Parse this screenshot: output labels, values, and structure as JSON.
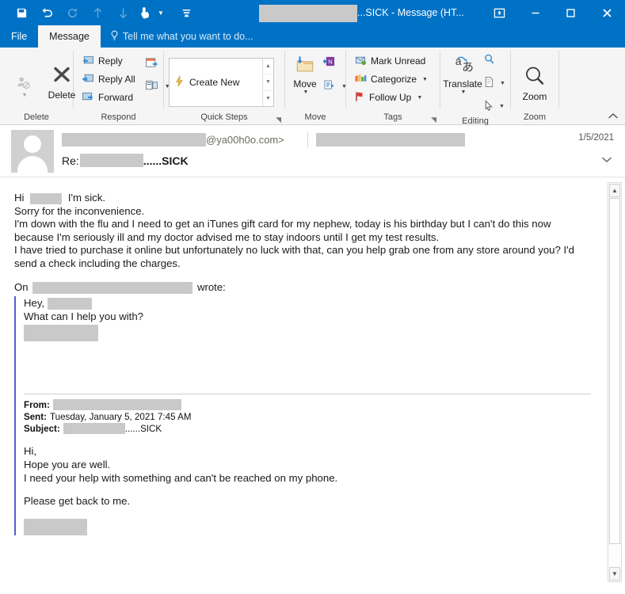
{
  "window": {
    "title_suffix": "...SICK - Message (HT...",
    "redacted_title": "",
    "quick_access": [
      {
        "name": "save-icon",
        "label": "Save",
        "enabled": true
      },
      {
        "name": "undo-icon",
        "label": "Undo",
        "enabled": true
      },
      {
        "name": "redo-icon",
        "label": "Redo",
        "enabled": false
      },
      {
        "name": "previous-item-icon",
        "label": "Previous Item",
        "enabled": false
      },
      {
        "name": "next-item-icon",
        "label": "Next Item",
        "enabled": false
      },
      {
        "name": "touch-mouse-mode-icon",
        "label": "Touch/Mouse Mode",
        "enabled": true
      },
      {
        "name": "customize-quick-access-toolbar-icon",
        "label": "Customize Quick Access Toolbar",
        "enabled": true
      }
    ],
    "controls": [
      {
        "name": "ribbon-display-options-button",
        "label": "Ribbon Display Options"
      },
      {
        "name": "minimize-button",
        "label": "Minimize"
      },
      {
        "name": "maximize-button",
        "label": "Maximize"
      },
      {
        "name": "close-button",
        "label": "Close"
      }
    ]
  },
  "tabs": {
    "file": "File",
    "message": "Message",
    "tellme_placeholder": "Tell me what you want to do..."
  },
  "ribbon": {
    "groups": [
      {
        "label": "Delete"
      },
      {
        "label": "Respond"
      },
      {
        "label": "Quick Steps"
      },
      {
        "label": "Move"
      },
      {
        "label": "Tags"
      },
      {
        "label": "Editing"
      },
      {
        "label": "Zoom"
      }
    ],
    "delete": {
      "ignore_label": "",
      "delete_label": "Delete"
    },
    "respond": {
      "reply": "Reply",
      "reply_all": "Reply All",
      "forward": "Forward"
    },
    "quick_steps": {
      "create_new": "Create New"
    },
    "move": {
      "move_label": "Move"
    },
    "tags": {
      "mark_unread": "Mark Unread",
      "categorize": "Categorize",
      "follow_up": "Follow Up"
    },
    "editing": {
      "translate": "Translate"
    },
    "zoom": {
      "zoom_label": "Zoom"
    }
  },
  "message_header": {
    "sender_redacted": "",
    "sender_domain": "@ya00h0o.com>",
    "recipient_redacted": "",
    "date": "1/5/2021",
    "subject_prefix": "Re:",
    "subject_redacted": "",
    "subject_suffix": "......SICK"
  },
  "body": {
    "greeting_prefix": "Hi",
    "greeting_suffix": "I'm sick.",
    "lines": [
      "Sorry for the inconvenience.",
      "I'm down with the flu and I need to get an iTunes gift card for my nephew, today is his birthday but I can't do this now because I'm seriously ill and my doctor advised me to stay indoors until I get my test results.",
      "I have tried to purchase it online but unfortunately no luck with that, can you help grab one from any store around you? I'd send a check including the charges."
    ],
    "on_prefix": "On",
    "on_suffix": "wrote:"
  },
  "quoted": {
    "greeting": "Hey,",
    "question": "What can I help you with?",
    "from_label": "From:",
    "sent_label": "Sent:",
    "sent_value": "Tuesday, January 5, 2021 7:45 AM",
    "subject_label": "Subject:",
    "subject_suffix": "......SICK",
    "lines": [
      "Hi,",
      "Hope you are well.",
      "I need your help with something and can't be reached on my phone."
    ],
    "closing": "Please get back to me."
  },
  "colors": {
    "titlebar": "#0072c6",
    "ribbon_bg": "#f5f5f5",
    "quote_bar": "#5b5bd6",
    "redaction": "#c9c9c9"
  }
}
